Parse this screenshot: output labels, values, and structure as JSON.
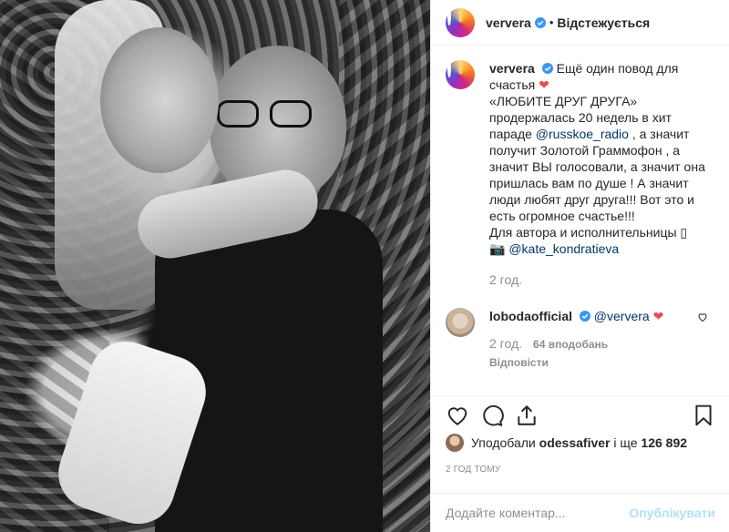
{
  "post": {
    "username": "ververa",
    "follow_status": "Відстежується",
    "dot": "•"
  },
  "caption": {
    "username": "ververa",
    "text_1": "Ещё один повод для счастья",
    "text_2": "«ЛЮБИТЕ ДРУГ ДРУГА» продержалась 20 недель в хит параде",
    "mention_1": "@russkoe_radio",
    "text_3": ", а значит получит Золотой Граммофон , а значит ВЫ голосовали, а значит она пришлась вам по душе ! А значит люди любят друг друга!!! Вот это и есть огромное счастье!!!",
    "text_4": "Для автора и исполнительницы ▯",
    "camera": "📷",
    "mention_2": "@kate_kondratieva",
    "time": "2 год."
  },
  "reply": {
    "username": "lobodaofficial",
    "mention": "@ververa",
    "time": "2 год.",
    "likes": "64 вподобань",
    "reply_label": "Відповісти"
  },
  "likes": {
    "prefix": "Уподобали",
    "user": "odessafiver",
    "middle": "і ще",
    "count": "126 892"
  },
  "posted": "2 ГОД ТОМУ",
  "add_comment": {
    "placeholder": "Додайте коментар...",
    "publish": "Опублікувати"
  },
  "colors": {
    "verified": "#3897f0",
    "heart": "#ed4956",
    "link": "#00376b",
    "publish_disabled": "#b2dffc"
  },
  "icons": [
    "verified-icon",
    "heart-icon",
    "comment-icon",
    "share-icon",
    "bookmark-icon",
    "camera-icon"
  ]
}
